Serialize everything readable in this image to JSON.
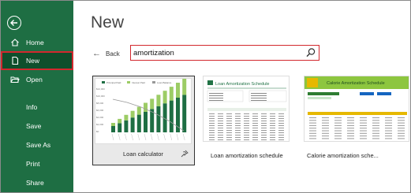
{
  "sidebar": {
    "items": [
      {
        "label": "Home",
        "icon": "home-icon"
      },
      {
        "label": "New",
        "icon": "new-document-icon",
        "active": true
      },
      {
        "label": "Open",
        "icon": "folder-open-icon"
      },
      {
        "label": "Info"
      },
      {
        "label": "Save"
      },
      {
        "label": "Save As"
      },
      {
        "label": "Print"
      },
      {
        "label": "Share"
      }
    ]
  },
  "main": {
    "title": "New",
    "back_label": "Back",
    "search": {
      "value": "amortization"
    }
  },
  "templates": [
    {
      "name": "Loan calculator",
      "selected": true
    },
    {
      "name": "Loan amortization schedule"
    },
    {
      "name": "Calorie amortization sche..."
    }
  ],
  "thumbnails": {
    "loan_calculator": {
      "legend": [
        "Principal Paid",
        "Interest Paid",
        "Loan Balance"
      ],
      "y_ticks": [
        "$12,000",
        "$10,000",
        "$8,000",
        "$6,000",
        "$4,000",
        "$2,000",
        "$0"
      ]
    },
    "loan_schedule": {
      "title": "Loan Amortization Schedule"
    },
    "calorie_schedule": {
      "title": "Calorie Amortization Schedule"
    }
  },
  "colors": {
    "sidebar": "#1e6e43",
    "active": "#0f4f2c",
    "highlight": "#d2282e",
    "accent": "#217346"
  }
}
